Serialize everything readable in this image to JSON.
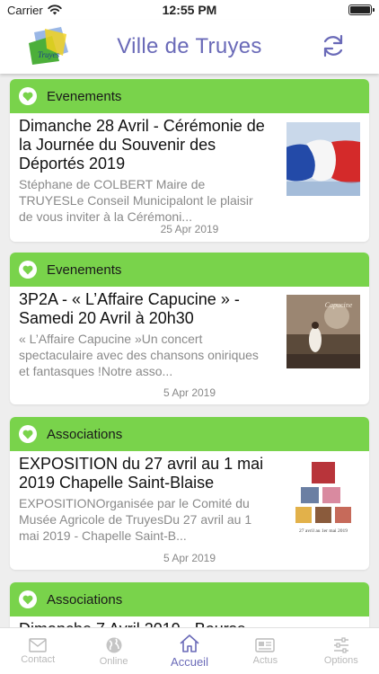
{
  "status_bar": {
    "carrier": "Carrier",
    "time": "12:55 PM"
  },
  "header": {
    "title": "Ville de Truyes",
    "logo_text": "Truyes"
  },
  "colors": {
    "accent": "#6a6ab8",
    "category_bar": "#79d34b",
    "inactive": "#b9b9b9"
  },
  "feed": [
    {
      "category": "Evenements",
      "title": "Dimanche 28 Avril - Cérémonie de la Journée du Souvenir des Déportés 2019",
      "excerpt": "Stéphane de COLBERT Maire de TRUYESLe Conseil Municipalont le plaisir de vous inviter à la Cérémoni...",
      "date": "25 Apr 2019",
      "thumbnail": "french-flag"
    },
    {
      "category": "Evenements",
      "title": "3P2A - « L’Affaire Capucine » - Samedi 20 Avril à 20h30",
      "excerpt": "« L’Affaire Capucine »Un concert spectaculaire avec des chansons oniriques et fantasques !Notre asso...",
      "date": "5 Apr 2019",
      "thumbnail": "capucine-poster",
      "thumbnail_text": "Capucine"
    },
    {
      "category": "Associations",
      "title": "EXPOSITION du 27 avril au 1 mai 2019 Chapelle Saint-Blaise",
      "excerpt": "EXPOSITIONOrganisée par le Comité du Musée Agricole de TruyesDu 27 avril au 1 mai 2019 - Chapelle Saint-B...",
      "date": "5 Apr 2019",
      "thumbnail": "exposition-collage",
      "thumbnail_text": "27 avril au 1er mai 2019"
    },
    {
      "category": "Associations",
      "title": "Dimanche 7 Avril 2019 - Bourse"
    }
  ],
  "tabs": [
    {
      "label": "Contact",
      "icon": "mail-icon",
      "active": false
    },
    {
      "label": "Online",
      "icon": "globe-icon",
      "active": false
    },
    {
      "label": "Accueil",
      "icon": "home-icon",
      "active": true
    },
    {
      "label": "Actus",
      "icon": "news-icon",
      "active": false
    },
    {
      "label": "Options",
      "icon": "sliders-icon",
      "active": false
    }
  ]
}
